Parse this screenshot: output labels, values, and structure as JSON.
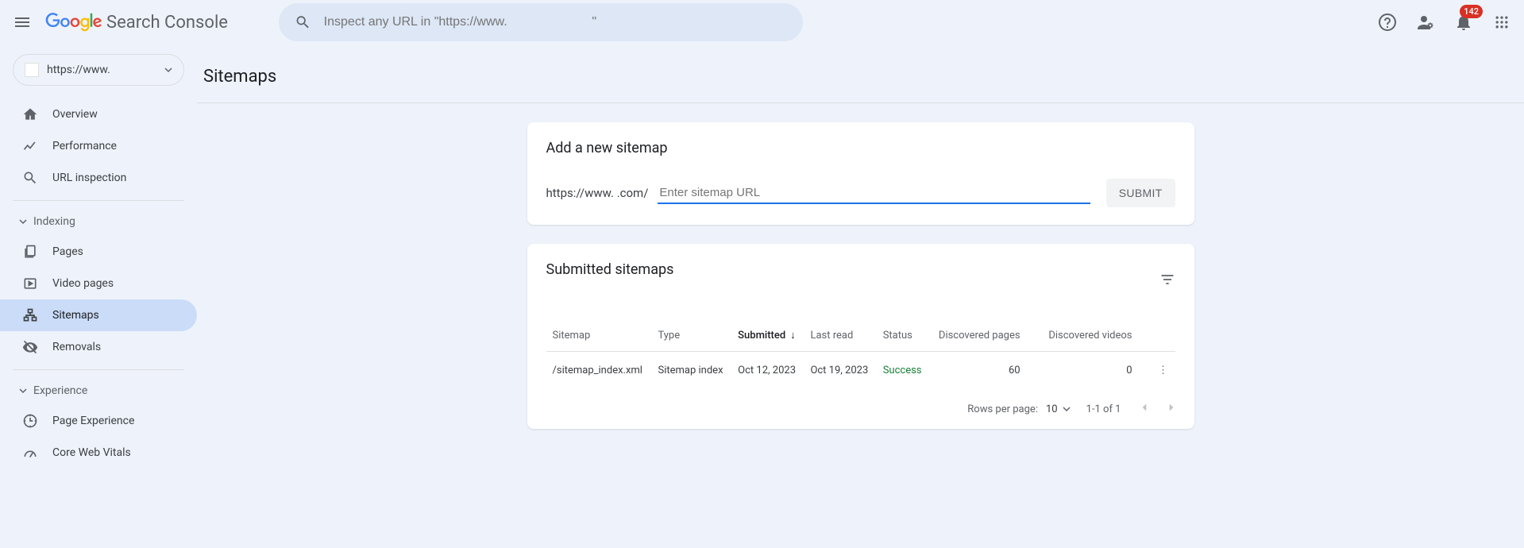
{
  "app_name": "Search Console",
  "search_placeholder": "Inspect any URL in \"https://www.                        \"",
  "notifications_count": "142",
  "property_selector": {
    "label": "https://www."
  },
  "sidebar": {
    "items": [
      {
        "label": "Overview"
      },
      {
        "label": "Performance"
      },
      {
        "label": "URL inspection"
      }
    ],
    "indexing_section": "Indexing",
    "indexing": [
      {
        "label": "Pages"
      },
      {
        "label": "Video pages"
      },
      {
        "label": "Sitemaps"
      },
      {
        "label": "Removals"
      }
    ],
    "experience_section": "Experience",
    "experience": [
      {
        "label": "Page Experience"
      },
      {
        "label": "Core Web Vitals"
      }
    ]
  },
  "page": {
    "title": "Sitemaps"
  },
  "add_card": {
    "title": "Add a new sitemap",
    "url_prefix": "https://www.                .com/",
    "input_placeholder": "Enter sitemap URL",
    "submit_label": "SUBMIT"
  },
  "table_card": {
    "title": "Submitted sitemaps",
    "columns": {
      "sitemap": "Sitemap",
      "type": "Type",
      "submitted": "Submitted",
      "last_read": "Last read",
      "status": "Status",
      "discovered_pages": "Discovered pages",
      "discovered_videos": "Discovered videos"
    },
    "rows": [
      {
        "sitemap": "/sitemap_index.xml",
        "type": "Sitemap index",
        "submitted": "Oct 12, 2023",
        "last_read": "Oct 19, 2023",
        "status": "Success",
        "discovered_pages": "60",
        "discovered_videos": "0"
      }
    ],
    "footer": {
      "rows_per_page_label": "Rows per page:",
      "rows_per_page_value": "10",
      "range": "1-1 of 1"
    }
  }
}
